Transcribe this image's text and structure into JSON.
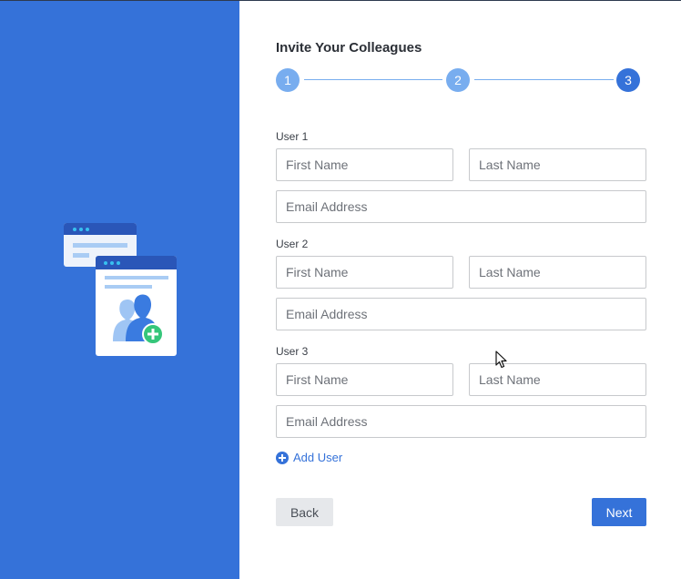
{
  "form": {
    "title": "Invite Your Colleagues",
    "steps": [
      {
        "label": "1",
        "state": "done"
      },
      {
        "label": "2",
        "state": "done"
      },
      {
        "label": "3",
        "state": "current"
      }
    ],
    "users": [
      {
        "label": "User 1",
        "first_placeholder": "First Name",
        "last_placeholder": "Last Name",
        "email_placeholder": "Email Address"
      },
      {
        "label": "User 2",
        "first_placeholder": "First Name",
        "last_placeholder": "Last Name",
        "email_placeholder": "Email Address"
      },
      {
        "label": "User 3",
        "first_placeholder": "First Name",
        "last_placeholder": "Last Name",
        "email_placeholder": "Email Address"
      }
    ],
    "add_user_label": "Add User",
    "back_label": "Back",
    "next_label": "Next"
  },
  "colors": {
    "panel_blue": "#3572d9",
    "step_done": "#78adef",
    "step_current": "#3572d9",
    "add_icon_green": "#35c67a"
  },
  "icons": {
    "illustration": "invite-users-illustration-icon",
    "add": "plus-circle-icon",
    "cursor": "mouse-pointer-icon"
  }
}
